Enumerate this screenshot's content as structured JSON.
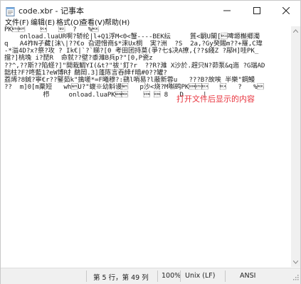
{
  "window": {
    "title": "code.xbr - 记事本"
  },
  "menu": [
    {
      "label": "文件(F)"
    },
    {
      "label": "编辑(E)"
    },
    {
      "label": "格式(O)"
    },
    {
      "label": "查看(V)"
    },
    {
      "label": "帮助(H)"
    }
  ],
  "editor": {
    "lines": [
      "PK\u0003\u0004    \u0014   \b  ?   %\u0006",
      "    onload.luaUR啊?轿纶|l+Q1浮M<0<蟹----BEK纭     質<嗣U閣[\u0012啤塬槲郷濁",
      "q   A4祚N孑藏[沫\\|??€o 旮遊愲商$*涞Ux桐  実?洲  ?S  2a,?Gy癸賜m??+羅,C瑋",
      "-*溢4D?x?祭?攻 ? Ik€|`?`睇?[0 考田团持莫(爭?七$决A撩,{??$綫Z ?鄬H]哇PK_",
      "擋?]桃堍 i?琵R  命就??壁?黍濰B兵p?\"[0,P瓷z",
      "??^,??斯??陷蛏?]\"開栽鯛YI(&t?\"祓'釘?r  ??R?濰 X沙於.趕只N?茆泵&q迤 ?G瑞AD",
      "韷柱?F?咚藍1?eW博R扌鷸岡.3]蓬陈言吞緈f暗#0??罐?",
      "荔烯?8鋮?寧€r??鋻茹k\"擒嗟*=F曦穆?:鷂l哨易?l蔽新蓉u   ???B?故唉 半樂\"鋼鰻",
      "??  m]0[m粟短   wh\u0019U?\"蝮※幼斛谩\u0019   p沙<烧?M嘝鹀PK\u0001\u0002\u0014   \u0014   ?   %\u0006",
      "          栉     onload.luaPK\u0005\u0006    \u0001 \u0001 8   D     |"
    ]
  },
  "annotation": "打开文件后显示的内容",
  "status": {
    "position": "第 5 行，第 49 列",
    "zoom": "100%",
    "line_ending": "Unix (LF)",
    "encoding": "ANSI"
  },
  "colors": {
    "annotation": "#e8323c",
    "statusbar": "#f0f0f0"
  }
}
